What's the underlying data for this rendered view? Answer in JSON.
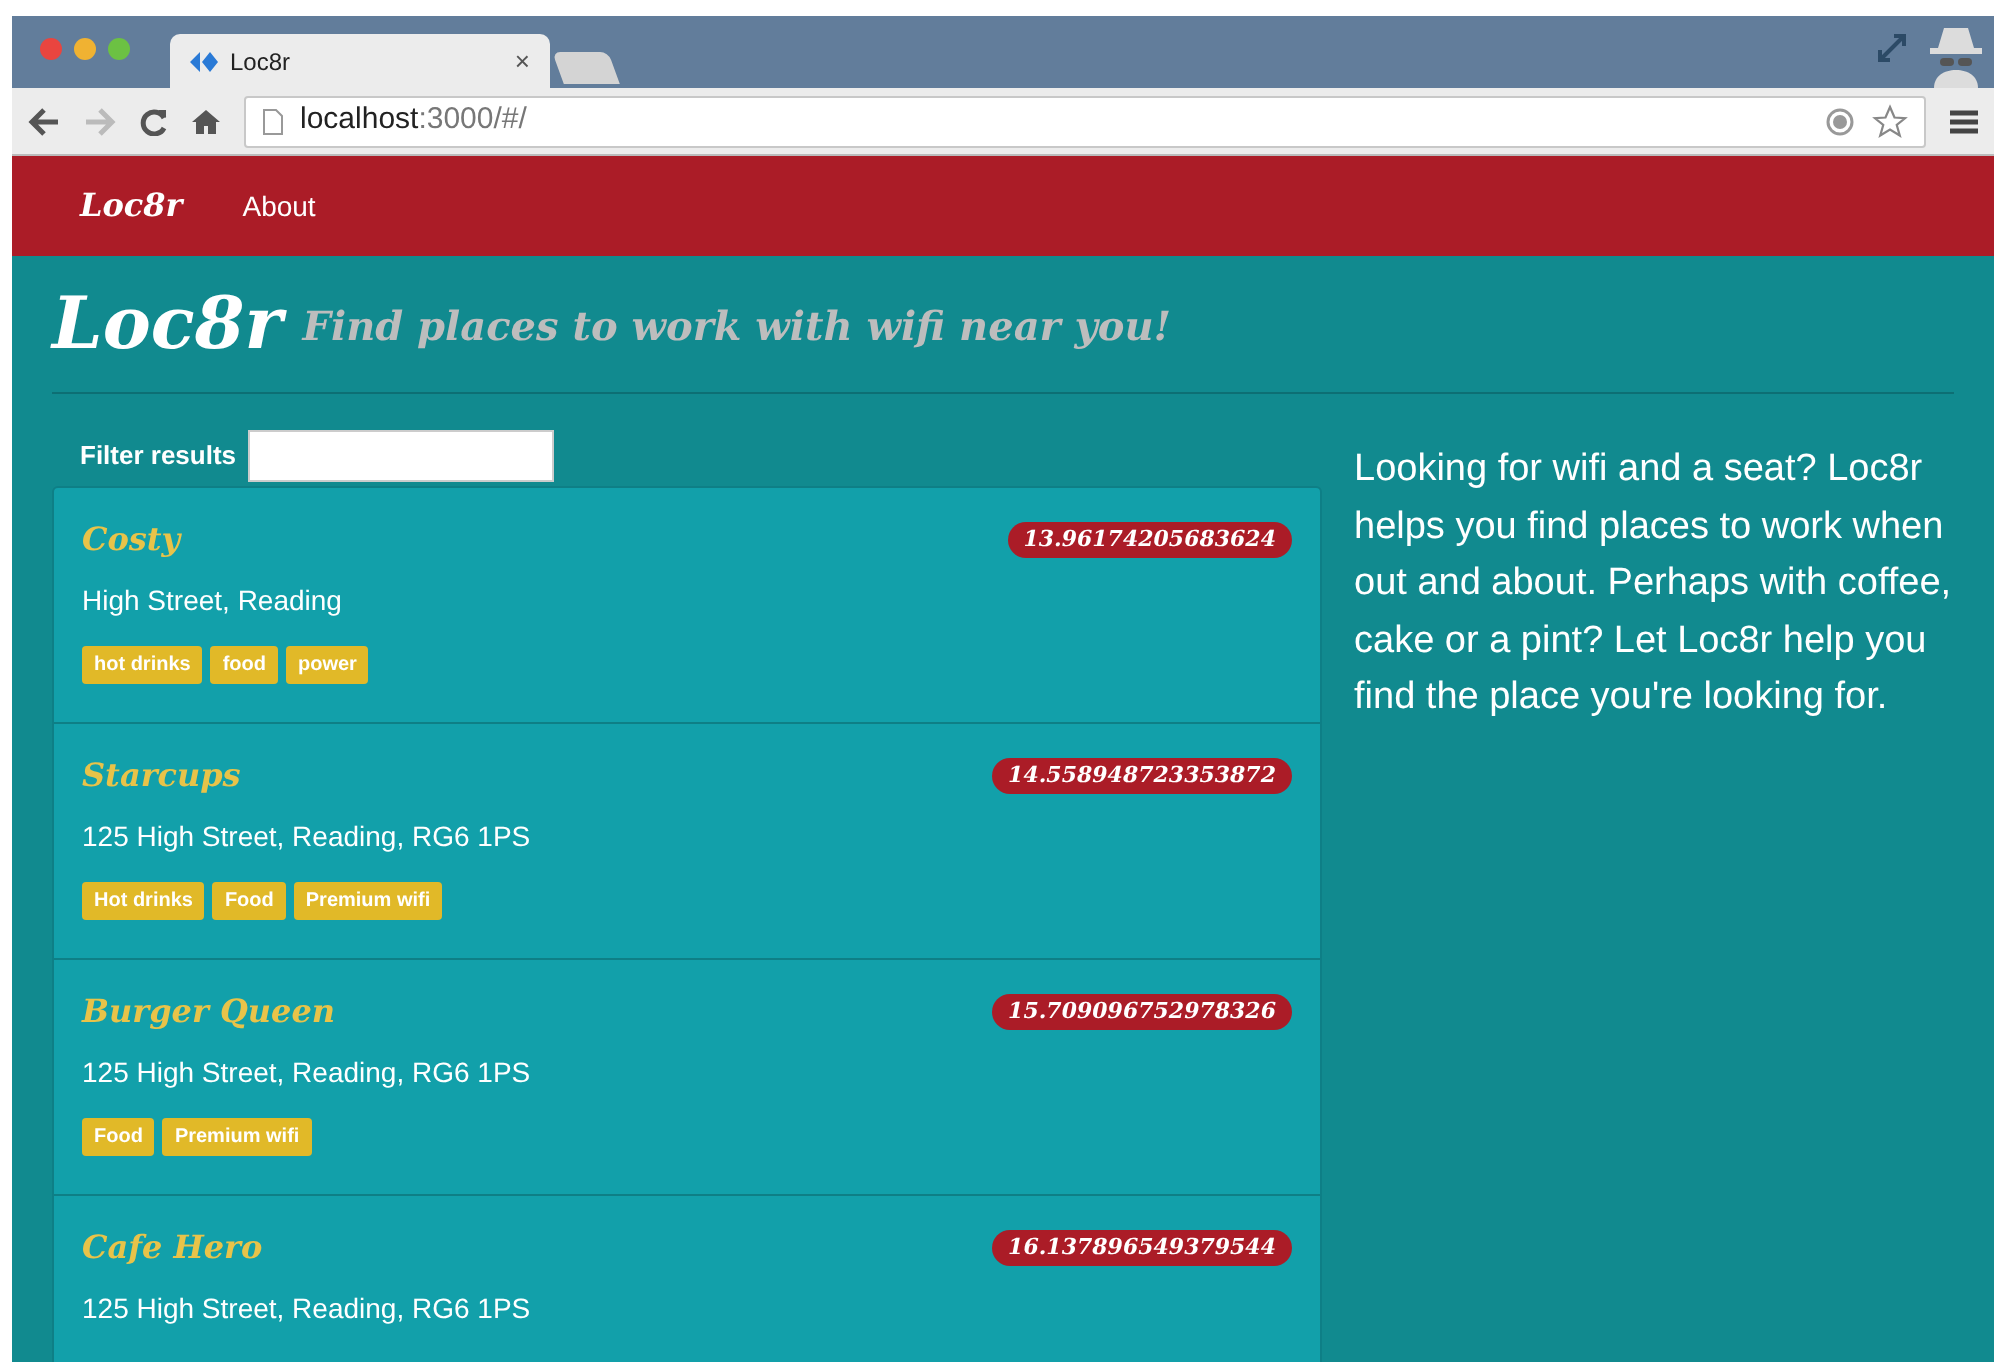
{
  "browser": {
    "tab_title": "Loc8r",
    "tab_close": "×",
    "url_host": "localhost",
    "url_rest": ":3000/#/"
  },
  "navbar": {
    "brand": "Loc8r",
    "links": [
      "About"
    ]
  },
  "header": {
    "title": "Loc8r",
    "tagline": "Find places to work with wifi near you!"
  },
  "filter": {
    "label": "Filter results"
  },
  "locations": [
    {
      "name": "Costy",
      "distance": "13.96174205683624",
      "address": "High Street, Reading",
      "facilities": [
        "hot drinks",
        "food",
        "power"
      ]
    },
    {
      "name": "Starcups",
      "distance": "14.558948723353872",
      "address": "125 High Street, Reading, RG6 1PS",
      "facilities": [
        "Hot drinks",
        "Food",
        "Premium wifi"
      ]
    },
    {
      "name": "Burger Queen",
      "distance": "15.709096752978326",
      "address": "125 High Street, Reading, RG6 1PS",
      "facilities": [
        "Food",
        "Premium wifi"
      ]
    },
    {
      "name": "Cafe Hero",
      "distance": "16.137896549379544",
      "address": "125 High Street, Reading, RG6 1PS"
    }
  ],
  "sidebar": {
    "text": "Looking for wifi and a seat? Loc8r helps you find places to work when out and about. Perhaps with coffee, cake or a pint? Let Loc8r help you find the place you're looking for."
  }
}
